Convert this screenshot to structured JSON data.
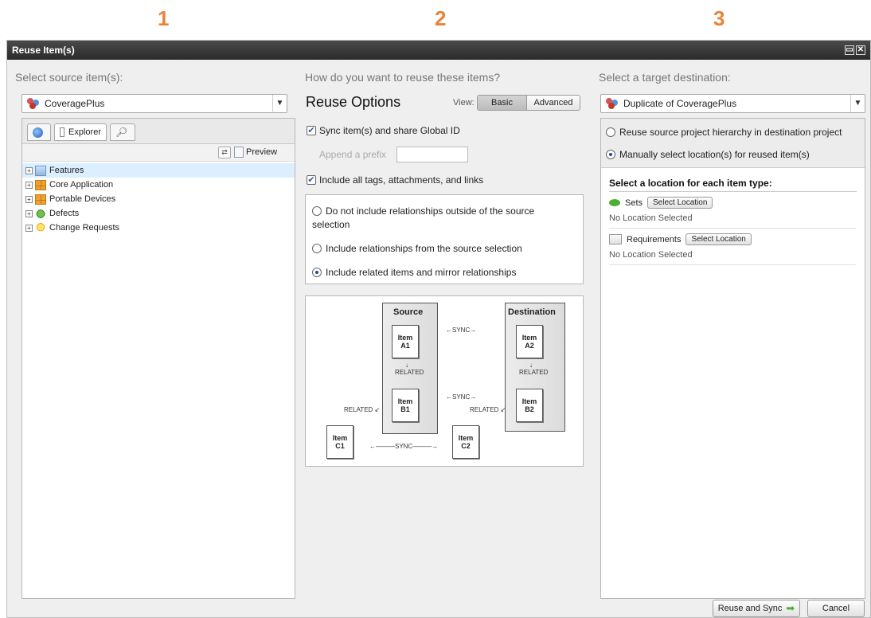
{
  "steps": [
    "1",
    "2",
    "3"
  ],
  "dialog": {
    "title": "Reuse Item(s)",
    "footer": {
      "reuse_label": "Reuse and Sync",
      "cancel_label": "Cancel"
    }
  },
  "source": {
    "heading": "Select source item(s):",
    "project": "CoveragePlus",
    "tabs": {
      "explorer": "Explorer"
    },
    "preview_label": "Preview",
    "tree": [
      {
        "label": "Features",
        "icon": "features-icon"
      },
      {
        "label": "Core Application",
        "icon": "folder-grid-icon"
      },
      {
        "label": "Portable Devices",
        "icon": "folder-grid-icon"
      },
      {
        "label": "Defects",
        "icon": "bug-icon"
      },
      {
        "label": "Change Requests",
        "icon": "lightbulb-icon"
      }
    ]
  },
  "options": {
    "heading": "How do you want to reuse these items?",
    "title": "Reuse Options",
    "view_label": "View:",
    "view_basic": "Basic",
    "view_advanced": "Advanced",
    "sync_label": "Sync item(s) and share Global ID",
    "prefix_label": "Append a prefix",
    "prefix_value": "",
    "include_tags_label": "Include all tags, attachments, and links",
    "relationships": [
      {
        "label": "Do not include relationships outside of the source selection",
        "selected": false
      },
      {
        "label": "Include relationships from the source selection",
        "selected": false
      },
      {
        "label": "Include related items and mirror relationships",
        "selected": true
      }
    ],
    "diagram": {
      "source": "Source",
      "destination": "Destination",
      "a1": "Item A1",
      "a2": "Item A2",
      "b1": "Item B1",
      "b2": "Item B2",
      "c1": "Item C1",
      "c2": "Item C2",
      "sync": "SYNC",
      "related": "RELATED"
    }
  },
  "target": {
    "heading": "Select a target destination:",
    "project": "Duplicate of CoveragePlus",
    "hierarchy_options": [
      {
        "label": "Reuse source project hierarchy in destination project",
        "selected": false
      },
      {
        "label": "Manually select location(s) for reused item(s)",
        "selected": true
      }
    ],
    "location_heading": "Select a location for each item type:",
    "item_types": [
      {
        "name": "Sets",
        "button": "Select Location",
        "status": "No Location Selected"
      },
      {
        "name": "Requirements",
        "button": "Select Location",
        "status": "No Location Selected"
      }
    ]
  },
  "colors": {
    "step_number": "#e8843a",
    "title_bar": "#2b2b2b",
    "accent_green": "#4caf2f"
  }
}
